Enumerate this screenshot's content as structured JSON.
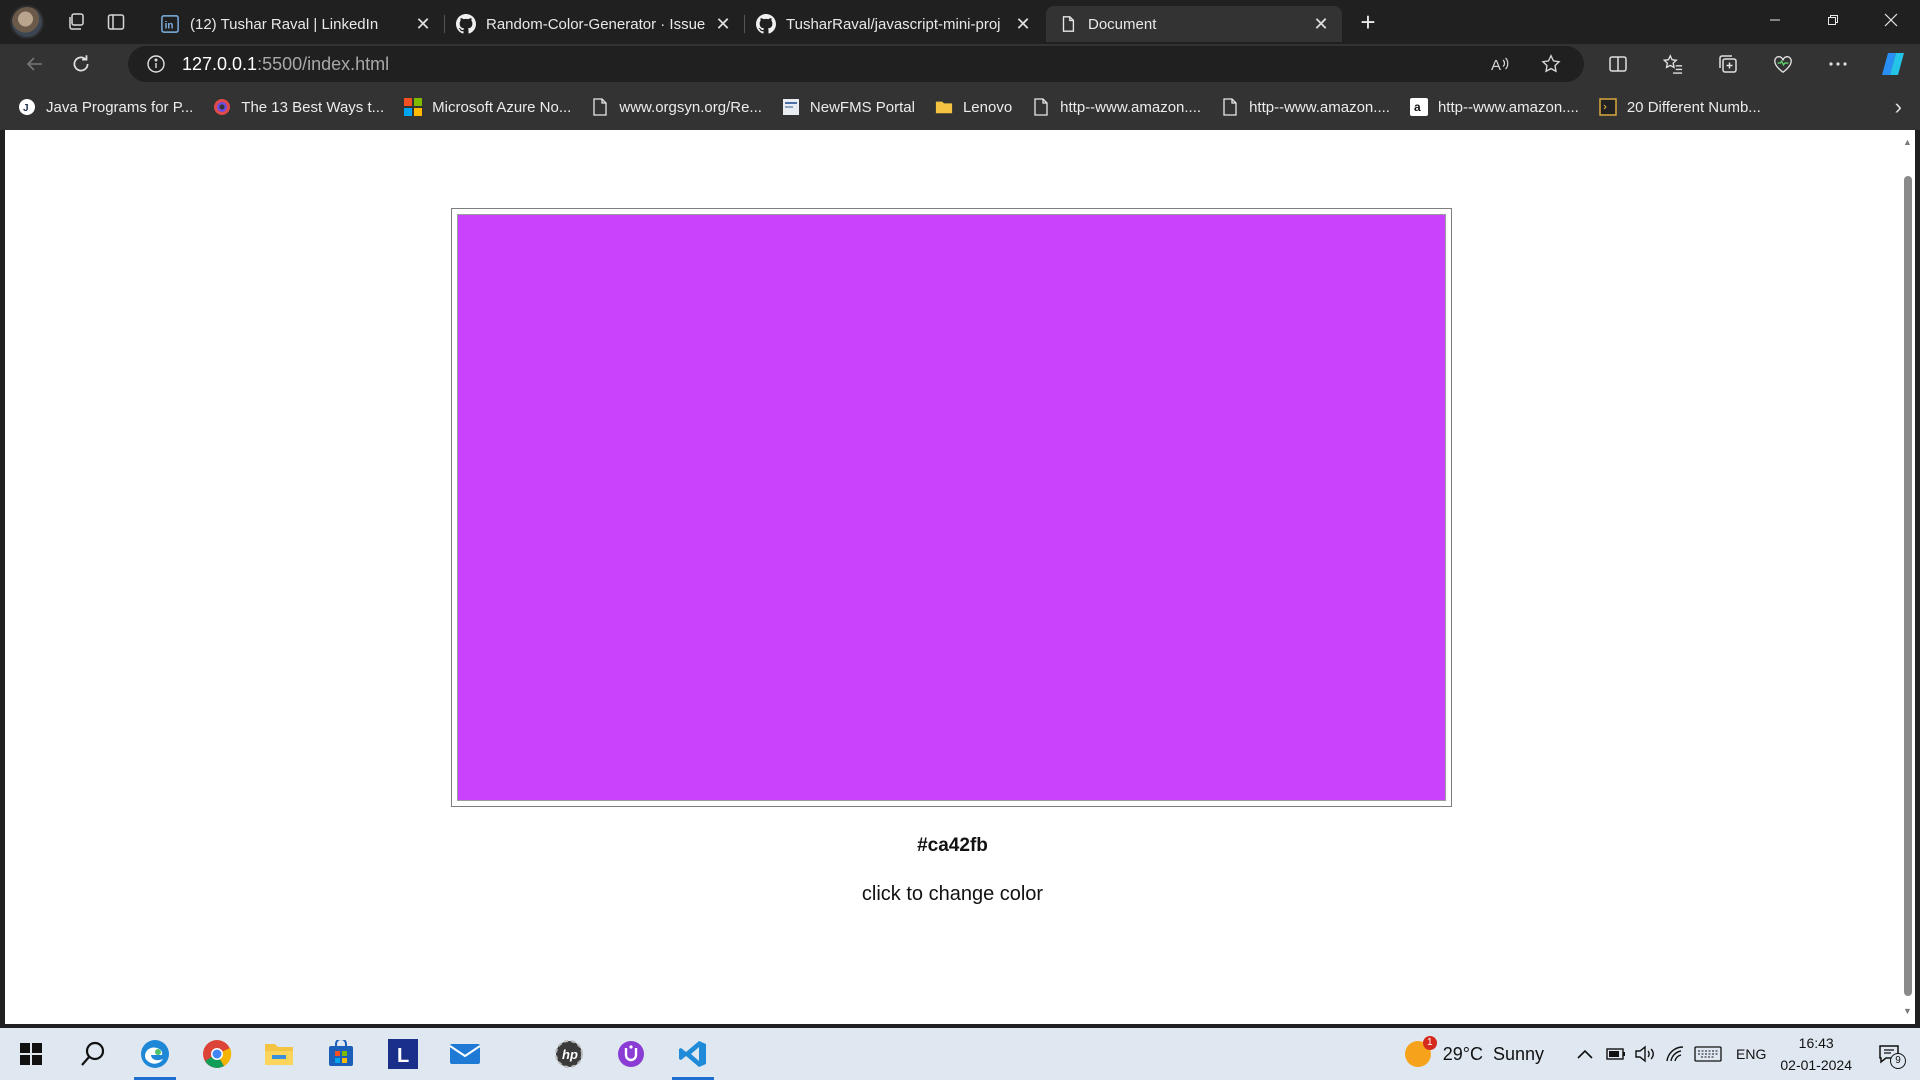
{
  "tabs": [
    {
      "title": "(12) Tushar Raval | LinkedIn",
      "icon": "linkedin-icon"
    },
    {
      "title": "Random-Color-Generator · Issue",
      "icon": "github-icon"
    },
    {
      "title": "TusharRaval/javascript-mini-proj",
      "icon": "github-icon"
    },
    {
      "title": "Document",
      "icon": "page-icon",
      "active": true
    }
  ],
  "address": {
    "host": "127.0.0.1",
    "path": ":5500/index.html"
  },
  "favorites": [
    {
      "label": "Java Programs for P...",
      "icon": "java-icon"
    },
    {
      "label": "The 13 Best Ways t...",
      "icon": "colorwheel-icon"
    },
    {
      "label": "Microsoft Azure No...",
      "icon": "microsoft-icon"
    },
    {
      "label": "www.orgsyn.org/Re...",
      "icon": "page-icon"
    },
    {
      "label": "NewFMS Portal",
      "icon": "portal-icon"
    },
    {
      "label": "Lenovo",
      "icon": "folder-icon"
    },
    {
      "label": "http--www.amazon....",
      "icon": "page-icon"
    },
    {
      "label": "http--www.amazon....",
      "icon": "page-icon"
    },
    {
      "label": "http--www.amazon....",
      "icon": "amazon-icon"
    },
    {
      "label": "20 Different Numb...",
      "icon": "code-icon"
    }
  ],
  "page": {
    "color": "#ca42fb",
    "hex_label": "#ca42fb",
    "hint": "click to change color"
  },
  "taskbar": {
    "apps": [
      "windows-start-icon",
      "search-icon",
      "edge-icon",
      "chrome-icon",
      "file-explorer-icon",
      "microsoft-store-icon",
      "lenovo-l-icon",
      "mail-icon",
      "hp-icon",
      "upwork-icon",
      "vscode-icon"
    ],
    "weather": {
      "temp": "29°C",
      "condition": "Sunny",
      "badge": "1"
    },
    "language": "ENG",
    "time": "16:43",
    "date": "02-01-2024",
    "notifications": "9"
  },
  "colors": {
    "accent": "#1f6fd1",
    "chrome_dark": "#202020",
    "chrome": "#333333"
  }
}
